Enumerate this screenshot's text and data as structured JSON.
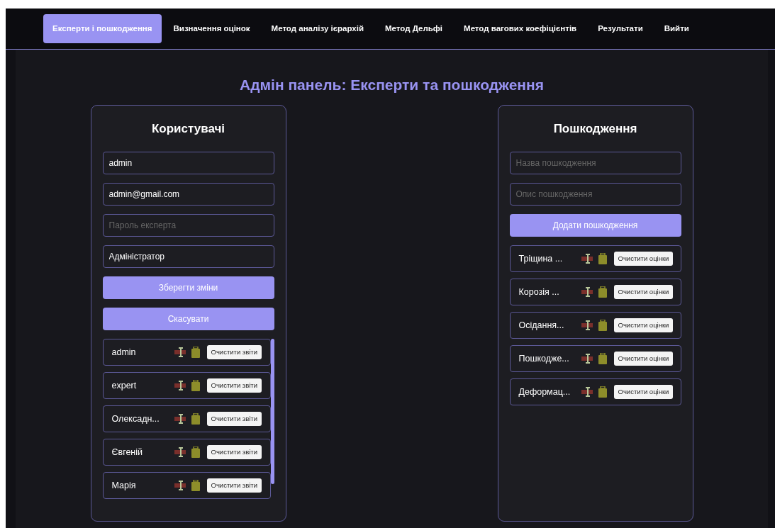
{
  "nav": [
    {
      "label": "Експерти і пошкодження",
      "selected": true
    },
    {
      "label": "Визначення оцінок",
      "selected": false
    },
    {
      "label": "Метод аналізу ієрархій",
      "selected": false
    },
    {
      "label": "Метод Дельфі",
      "selected": false
    },
    {
      "label": "Метод вагових коефіцієнтів",
      "selected": false
    },
    {
      "label": "Результати",
      "selected": false
    },
    {
      "label": "Вийти",
      "selected": false
    }
  ],
  "page_title": "Адмін панель: Експерти та пошкодження",
  "users_panel": {
    "title": "Користувачі",
    "fields": [
      {
        "value": "admin"
      },
      {
        "value": "admin@gmail.com"
      },
      {
        "placeholder": "Пароль експерта"
      },
      {
        "value": "Адміністратор"
      }
    ],
    "buttons": [
      "Зберегти зміни",
      "Скасувати"
    ],
    "items": [
      {
        "name": "admin",
        "action": "Очистити звіти"
      },
      {
        "name": "expert",
        "action": "Очистити звіти"
      },
      {
        "name": "Олексадн...",
        "action": "Очистити звіти"
      },
      {
        "name": "Євгеній",
        "action": "Очистити звіти"
      },
      {
        "name": "Марія",
        "action": "Очистити звіти"
      }
    ]
  },
  "damages_panel": {
    "title": "Пошкодження",
    "fields": [
      {
        "placeholder": "Назва пошкодження"
      },
      {
        "placeholder": "Опис пошкодження"
      }
    ],
    "buttons": [
      "Додати пошкодження"
    ],
    "items": [
      {
        "name": "Тріщина ...",
        "action": "Очистити оцінки"
      },
      {
        "name": "Корозія ...",
        "action": "Очистити оцінки"
      },
      {
        "name": "Осідання...",
        "action": "Очистити оцінки"
      },
      {
        "name": "Пошкодже...",
        "action": "Очистити оцінки"
      },
      {
        "name": "Деформац...",
        "action": "Очистити оцінки"
      }
    ]
  }
}
